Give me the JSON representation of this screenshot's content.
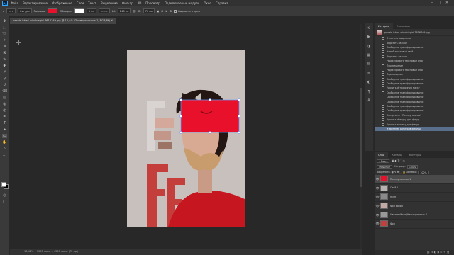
{
  "colors": {
    "accent": "#e8102a",
    "app_bg": "#282828",
    "panel": "#323232",
    "selection": "#5a6f8c",
    "canvas_bg": "#c8c0bd"
  },
  "app": {
    "logo": "Ps",
    "menu": [
      "Файл",
      "Редактирование",
      "Изображение",
      "Слои",
      "Текст",
      "Выделение",
      "Фильтр",
      "3D",
      "Просмотр",
      "Подключаемые модули",
      "Окно",
      "Справка"
    ]
  },
  "options": {
    "mode_label": "Фигура",
    "fill_label": "Заливка:",
    "stroke_label": "Обводка:",
    "stroke_size": "1 пт",
    "w_label": "Ш:",
    "w_value": "240 пк",
    "h_label": "В:",
    "h_value": "76 пк",
    "align_edges": "Выровнять края"
  },
  "document": {
    "tab": "pexels-ichad-windhiagiri-7616749.jpg @ 16,4% (Прямоугольник 1, RGB/8*)"
  },
  "status": {
    "zoom": "16,42%",
    "info": "3000 пикс. x 4500 пикс. (72 ppi)"
  },
  "history": {
    "tabs": [
      "История",
      "Операции"
    ],
    "snapshot": "pexels-ichad-windhiagiri-7616749.jpg",
    "items": [
      "Отменить выделение",
      "Вырезать на слое",
      "Свободное трансформирование",
      "Новый текстовый слой",
      "Вырезать на слое",
      "Редактировать текстовый слой",
      "Перемещение",
      "Редактировать текстовый слой",
      "Перемещение",
      "Свободное трансформирование",
      "Свободное трансформирование",
      "Удалить обтравочную маску",
      "Свободное трансформирование",
      "Свободное трансформирование",
      "Свободное трансформирование",
      "Свободное трансформирование",
      "Свободное трансформирование",
      "Инструмент \"Прямоугольник\"",
      "Удалить обводку для фигур",
      "Удалить заливку для фигур",
      "Изменение размеров фигуры"
    ],
    "selected_index": 20
  },
  "layers": {
    "tabs": [
      "Слои",
      "Каналы",
      "Контуры"
    ],
    "kind": "Вид",
    "blend": "Обычные",
    "opacity_label": "Непрозр.:",
    "opacity": "100%",
    "lock_label": "Закрепить:",
    "fill_label": "Заливка:",
    "fill": "100%",
    "items": [
      {
        "name": "Прямоугольник 1",
        "thumb": "#e8102a",
        "selected": true
      },
      {
        "name": "Слой 1",
        "thumb": "#b9b2b0",
        "selected": false
      },
      {
        "name": "REFR",
        "thumb": "#8a8a8a",
        "selected": false
      },
      {
        "name": "Фон копия",
        "thumb": "#c3a9a4",
        "selected": false
      },
      {
        "name": "Цветовой тон/Насыщенность 1",
        "thumb": "#999999",
        "selected": false
      },
      {
        "name": "Фон",
        "thumb": "#c04040",
        "selected": false
      }
    ]
  },
  "art": {
    "text": "REFR"
  }
}
